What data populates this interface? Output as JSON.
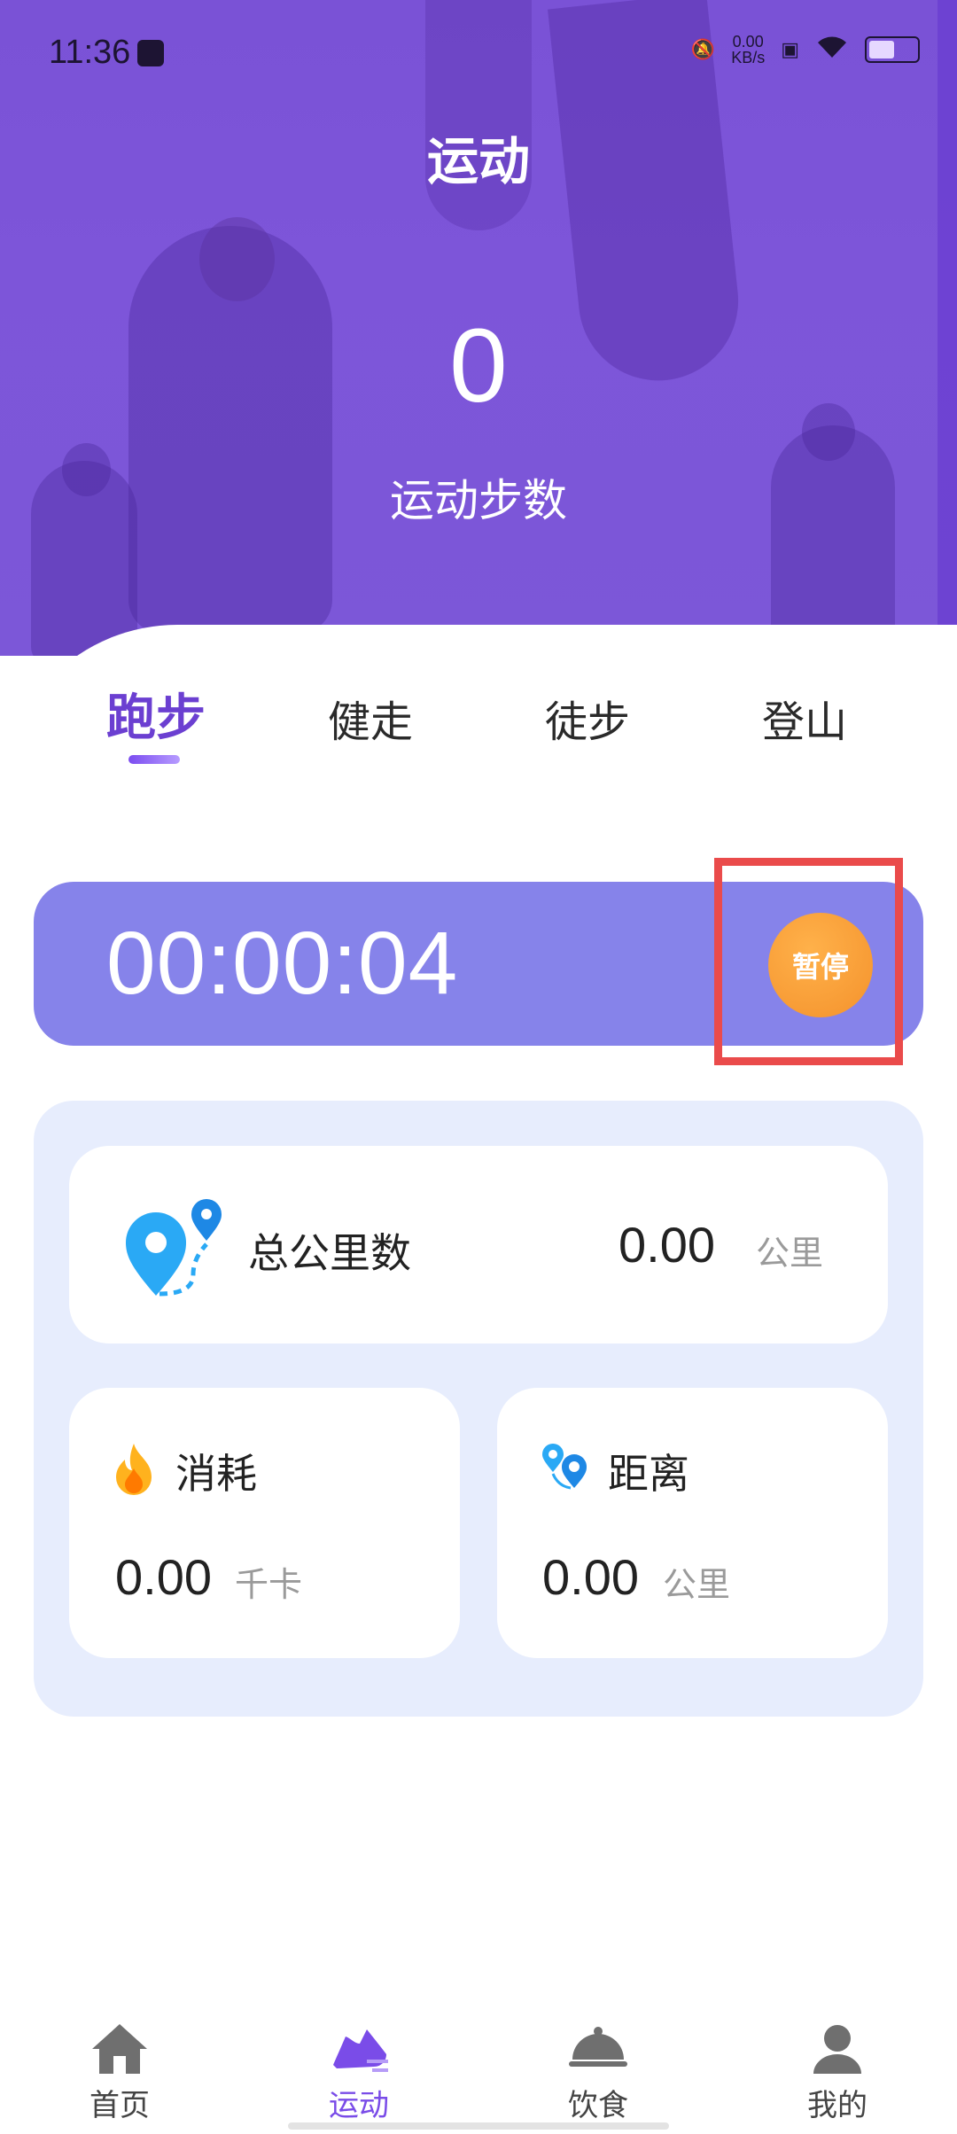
{
  "status_bar": {
    "time": "11:36",
    "net_speed": "0.00",
    "net_unit": "KB/s"
  },
  "header": {
    "title": "运动",
    "steps_value": "0",
    "steps_label": "运动步数"
  },
  "tabs": [
    {
      "label": "跑步",
      "active": true
    },
    {
      "label": "健走",
      "active": false
    },
    {
      "label": "徒步",
      "active": false
    },
    {
      "label": "登山",
      "active": false
    }
  ],
  "timer": {
    "value": "00:00:04",
    "pause_label": "暂停"
  },
  "stats": {
    "total": {
      "label": "总公里数",
      "value": "0.00",
      "unit": "公里"
    },
    "calories": {
      "label": "消耗",
      "value": "0.00",
      "unit": "千卡"
    },
    "distance": {
      "label": "距离",
      "value": "0.00",
      "unit": "公里"
    }
  },
  "nav": [
    {
      "label": "首页",
      "icon": "home-icon"
    },
    {
      "label": "运动",
      "icon": "running-shoe-icon",
      "active": true
    },
    {
      "label": "饮食",
      "icon": "food-cloche-icon"
    },
    {
      "label": "我的",
      "icon": "user-icon"
    }
  ],
  "colors": {
    "header_bg": "#7c57d8",
    "accent": "#6b3fd1",
    "timer_bg": "#8683ea",
    "pause_button": "#f4922c",
    "stats_bg": "#e7edfd",
    "highlight_border": "#ea4b4b"
  }
}
